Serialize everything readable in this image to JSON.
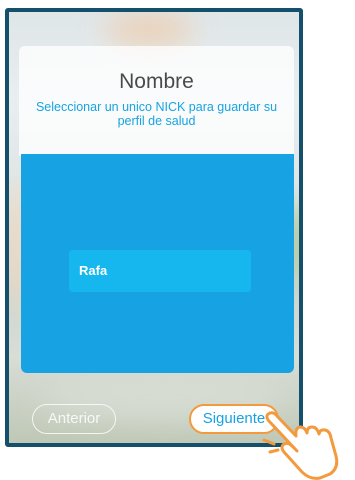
{
  "screen": {
    "title": "Nombre",
    "subtitle": "Seleccionar un unico NICK para guardar su perfil de salud"
  },
  "form": {
    "name_value": "Rafa"
  },
  "navigation": {
    "previous_label": "Anterior",
    "next_label": "Siguiente"
  },
  "overlay": {
    "pointer_icon": "hand-pointer-icon"
  },
  "colors": {
    "frame": "#144f6b",
    "accent_blue": "#17a2e4",
    "field_blue": "#16b7ee",
    "highlight_orange": "#f39a3c"
  }
}
